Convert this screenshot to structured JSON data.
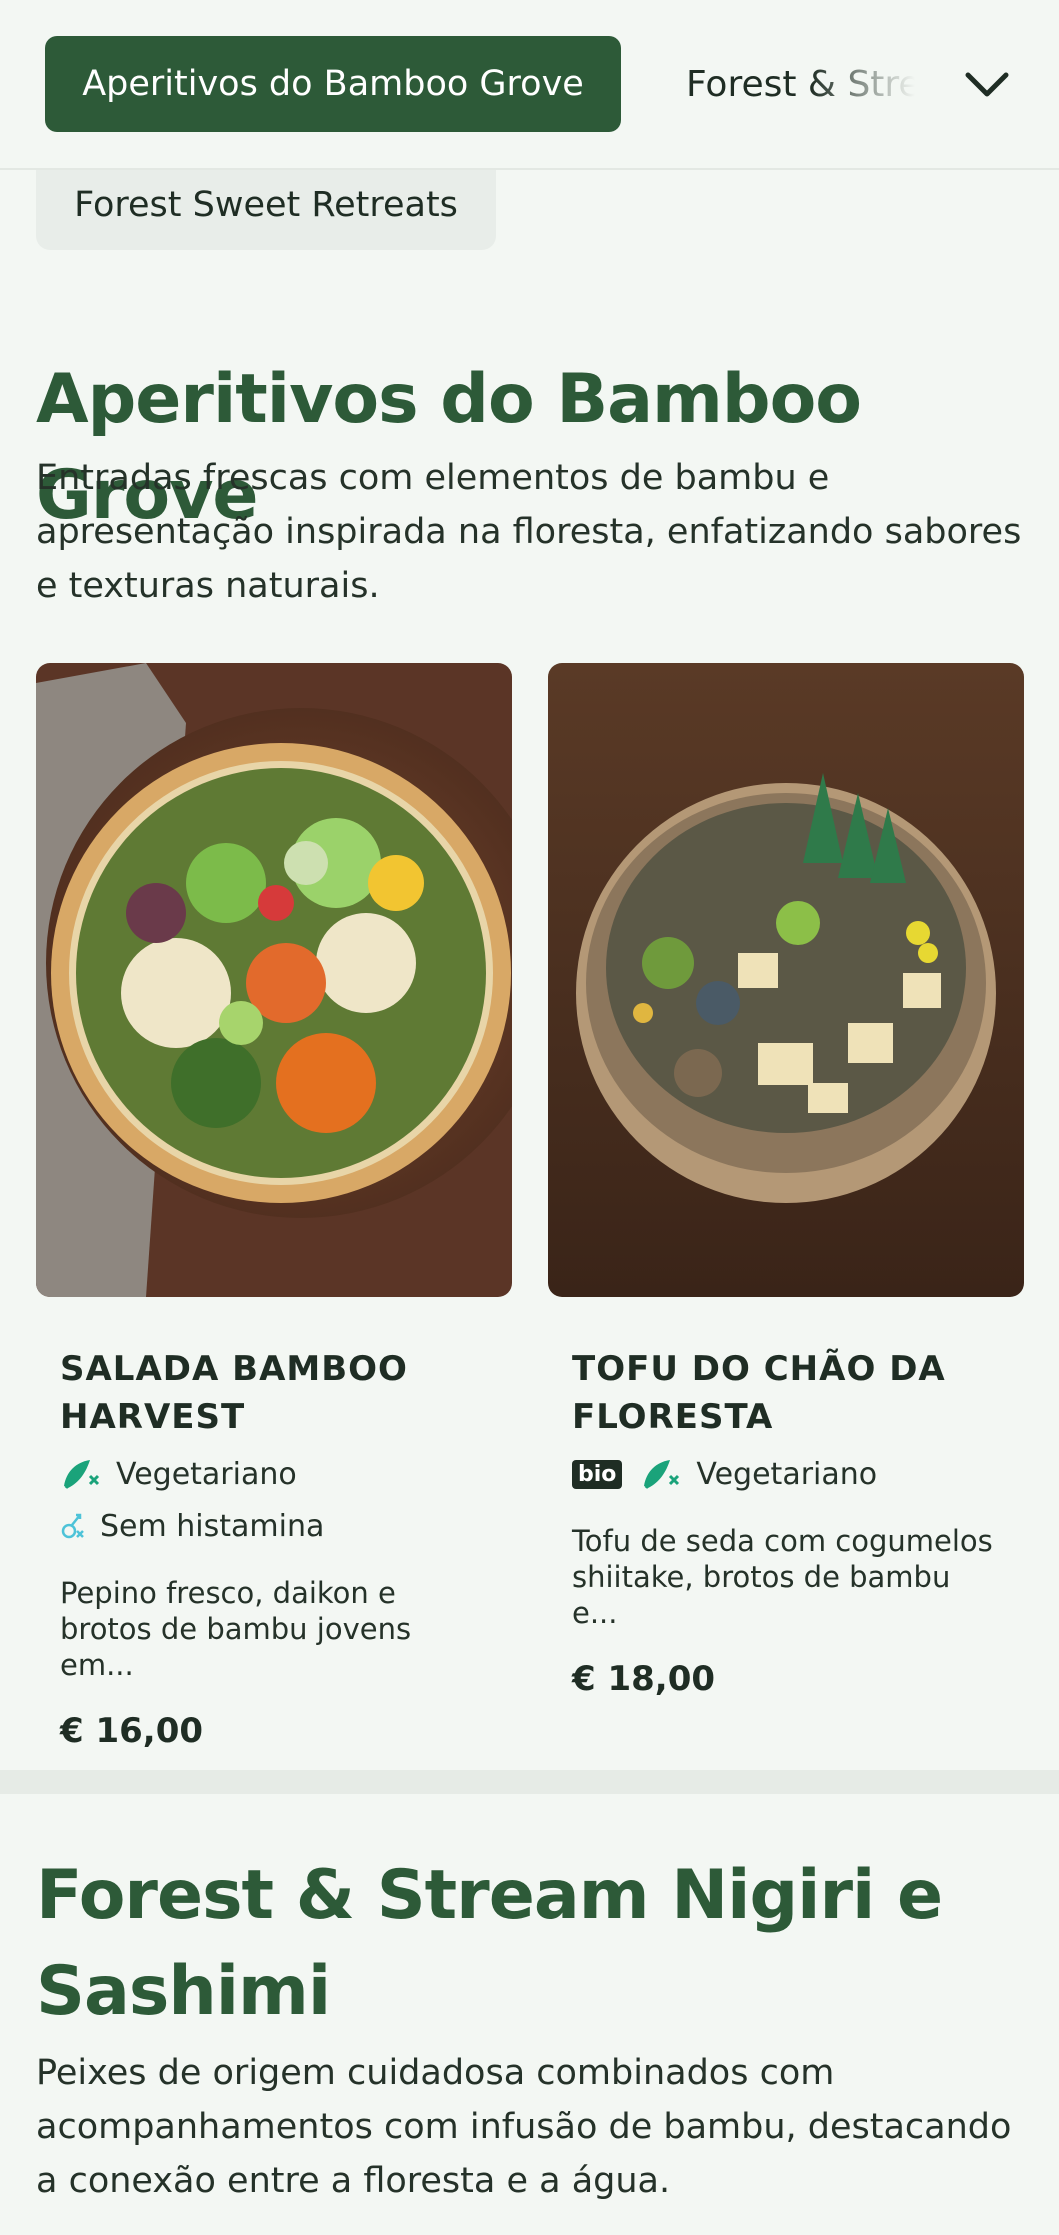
{
  "nav": {
    "active_category": "Aperitivos do Bamboo Grove",
    "next_category": "Forest & Stream",
    "overflow_category": "Forest Sweet Retreats"
  },
  "sections": [
    {
      "title": "Aperitivos do Bamboo Grove",
      "description": "Entradas frescas com elementos de bambu e apresentação inspirada na floresta, enfatizando sabores e texturas naturais."
    },
    {
      "title_line1": "Forest & Stream Nigiri e",
      "title_line2": "Sashimi",
      "description": "Peixes de origem cuidadosa combinados com acompanhamentos com infusão de bambu, destacando a conexão entre a floresta e a água."
    }
  ],
  "dishes": [
    {
      "name": "Salada Bamboo Harvest",
      "tags": [
        "Vegetariano",
        "Sem histamina"
      ],
      "description": "Pepino fresco, daikon e brotos de bambu jovens em...",
      "price": "€ 16,00"
    },
    {
      "name": "Tofu do Chão da Floresta",
      "badge": "bio",
      "tags": [
        "Vegetariano"
      ],
      "description": "Tofu de seda com cogumelos shiitake, brotos de bambu e...",
      "price": "€ 18,00"
    }
  ],
  "colors": {
    "primary": "#2d5a38",
    "background": "#f3f7f3",
    "tag_green": "#1aa37a",
    "tag_cyan": "#4dc3d8"
  },
  "icons": [
    "chevron-down-icon",
    "vegetarian-icon",
    "histamine-free-icon"
  ]
}
